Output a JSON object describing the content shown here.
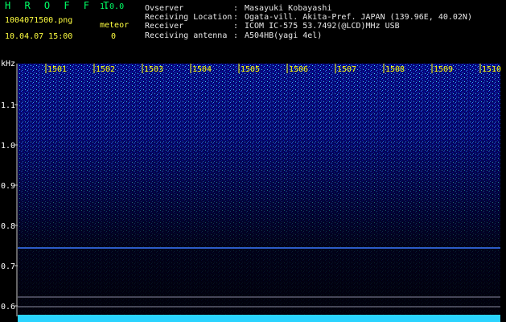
{
  "header": {
    "logo": "H R O F F T",
    "version": "1.0.0",
    "file_name": "1004071500.png",
    "meteor_label": "meteor",
    "date_time": "10.04.07 15:00",
    "meteor_count": "0"
  },
  "info": [
    {
      "key": "Ovserver",
      "value": "Masayuki Kobayashi"
    },
    {
      "key": "Receiving Location",
      "value": "Ogata-vill. Akita-Pref. JAPAN (139.96E, 40.02N)"
    },
    {
      "key": "Receiver",
      "value": "ICOM IC-575 53.7492(@LCD)MHz USB"
    },
    {
      "key": "Receiving antenna",
      "value": "A504HB(yagi 4el)"
    }
  ],
  "spectrogram": {
    "y_unit": "kHz",
    "y_ticks": [
      "1.1",
      "1.0",
      "0.9",
      "0.8",
      "0.7",
      "0.6"
    ],
    "time_ticks": [
      "1501",
      "1502",
      "1503",
      "1504",
      "1505",
      "1506",
      "1507",
      "1508",
      "1509",
      "1510"
    ],
    "tick_color": "#ffff00"
  }
}
